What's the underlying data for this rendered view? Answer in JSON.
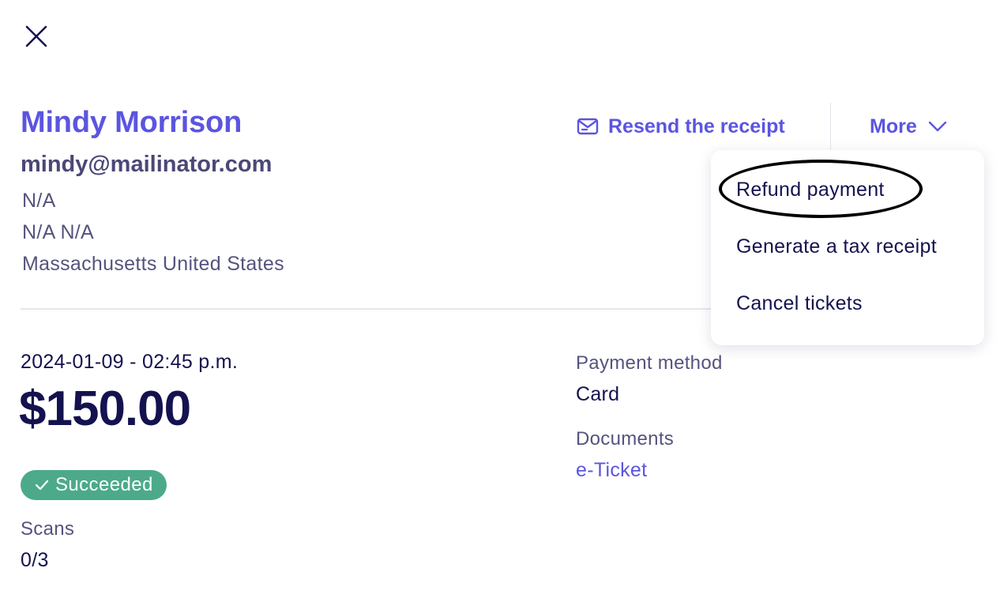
{
  "header": {
    "close_icon": "close-icon"
  },
  "customer": {
    "name": "Mindy Morrison",
    "email": "mindy@mailinator.com",
    "address_line1": "N/A",
    "address_line2": "N/A N/A",
    "address_line3": "Massachusetts United States"
  },
  "actions": {
    "resend_label": "Resend the receipt",
    "resend_icon": "mail-icon",
    "more_label": "More",
    "more_icon": "chevron-down-icon"
  },
  "dropdown": {
    "items": [
      {
        "label": "Refund payment"
      },
      {
        "label": "Generate a tax receipt"
      },
      {
        "label": "Cancel tickets"
      }
    ]
  },
  "transaction": {
    "datetime": "2024-01-09 - 02:45 p.m.",
    "amount": "$150.00",
    "status": "Succeeded",
    "status_icon": "check-icon",
    "status_color": "#4caa8b",
    "scans_label": "Scans",
    "scans_value": "0/3"
  },
  "payment": {
    "method_label": "Payment method",
    "method_value": "Card",
    "documents_label": "Documents",
    "documents_link": "e-Ticket"
  },
  "colors": {
    "accent": "#5b55e0",
    "text_dark": "#14124f",
    "text_muted": "#55537e",
    "success": "#4caa8b"
  }
}
